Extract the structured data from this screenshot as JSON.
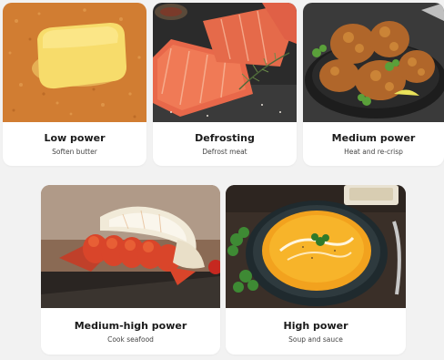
{
  "modes": [
    {
      "title": "Low power",
      "subtitle": "Soften butter",
      "image": "butter-on-toast"
    },
    {
      "title": "Defrosting",
      "subtitle": "Defrost meat",
      "image": "salmon-fillets"
    },
    {
      "title": "Medium power",
      "subtitle": "Heat and re-crisp",
      "image": "fried-chicken"
    },
    {
      "title": "Medium-high power",
      "subtitle": "Cook seafood",
      "image": "lobster-tail"
    },
    {
      "title": "High power",
      "subtitle": "Soup and sauce",
      "image": "pumpkin-soup"
    }
  ]
}
